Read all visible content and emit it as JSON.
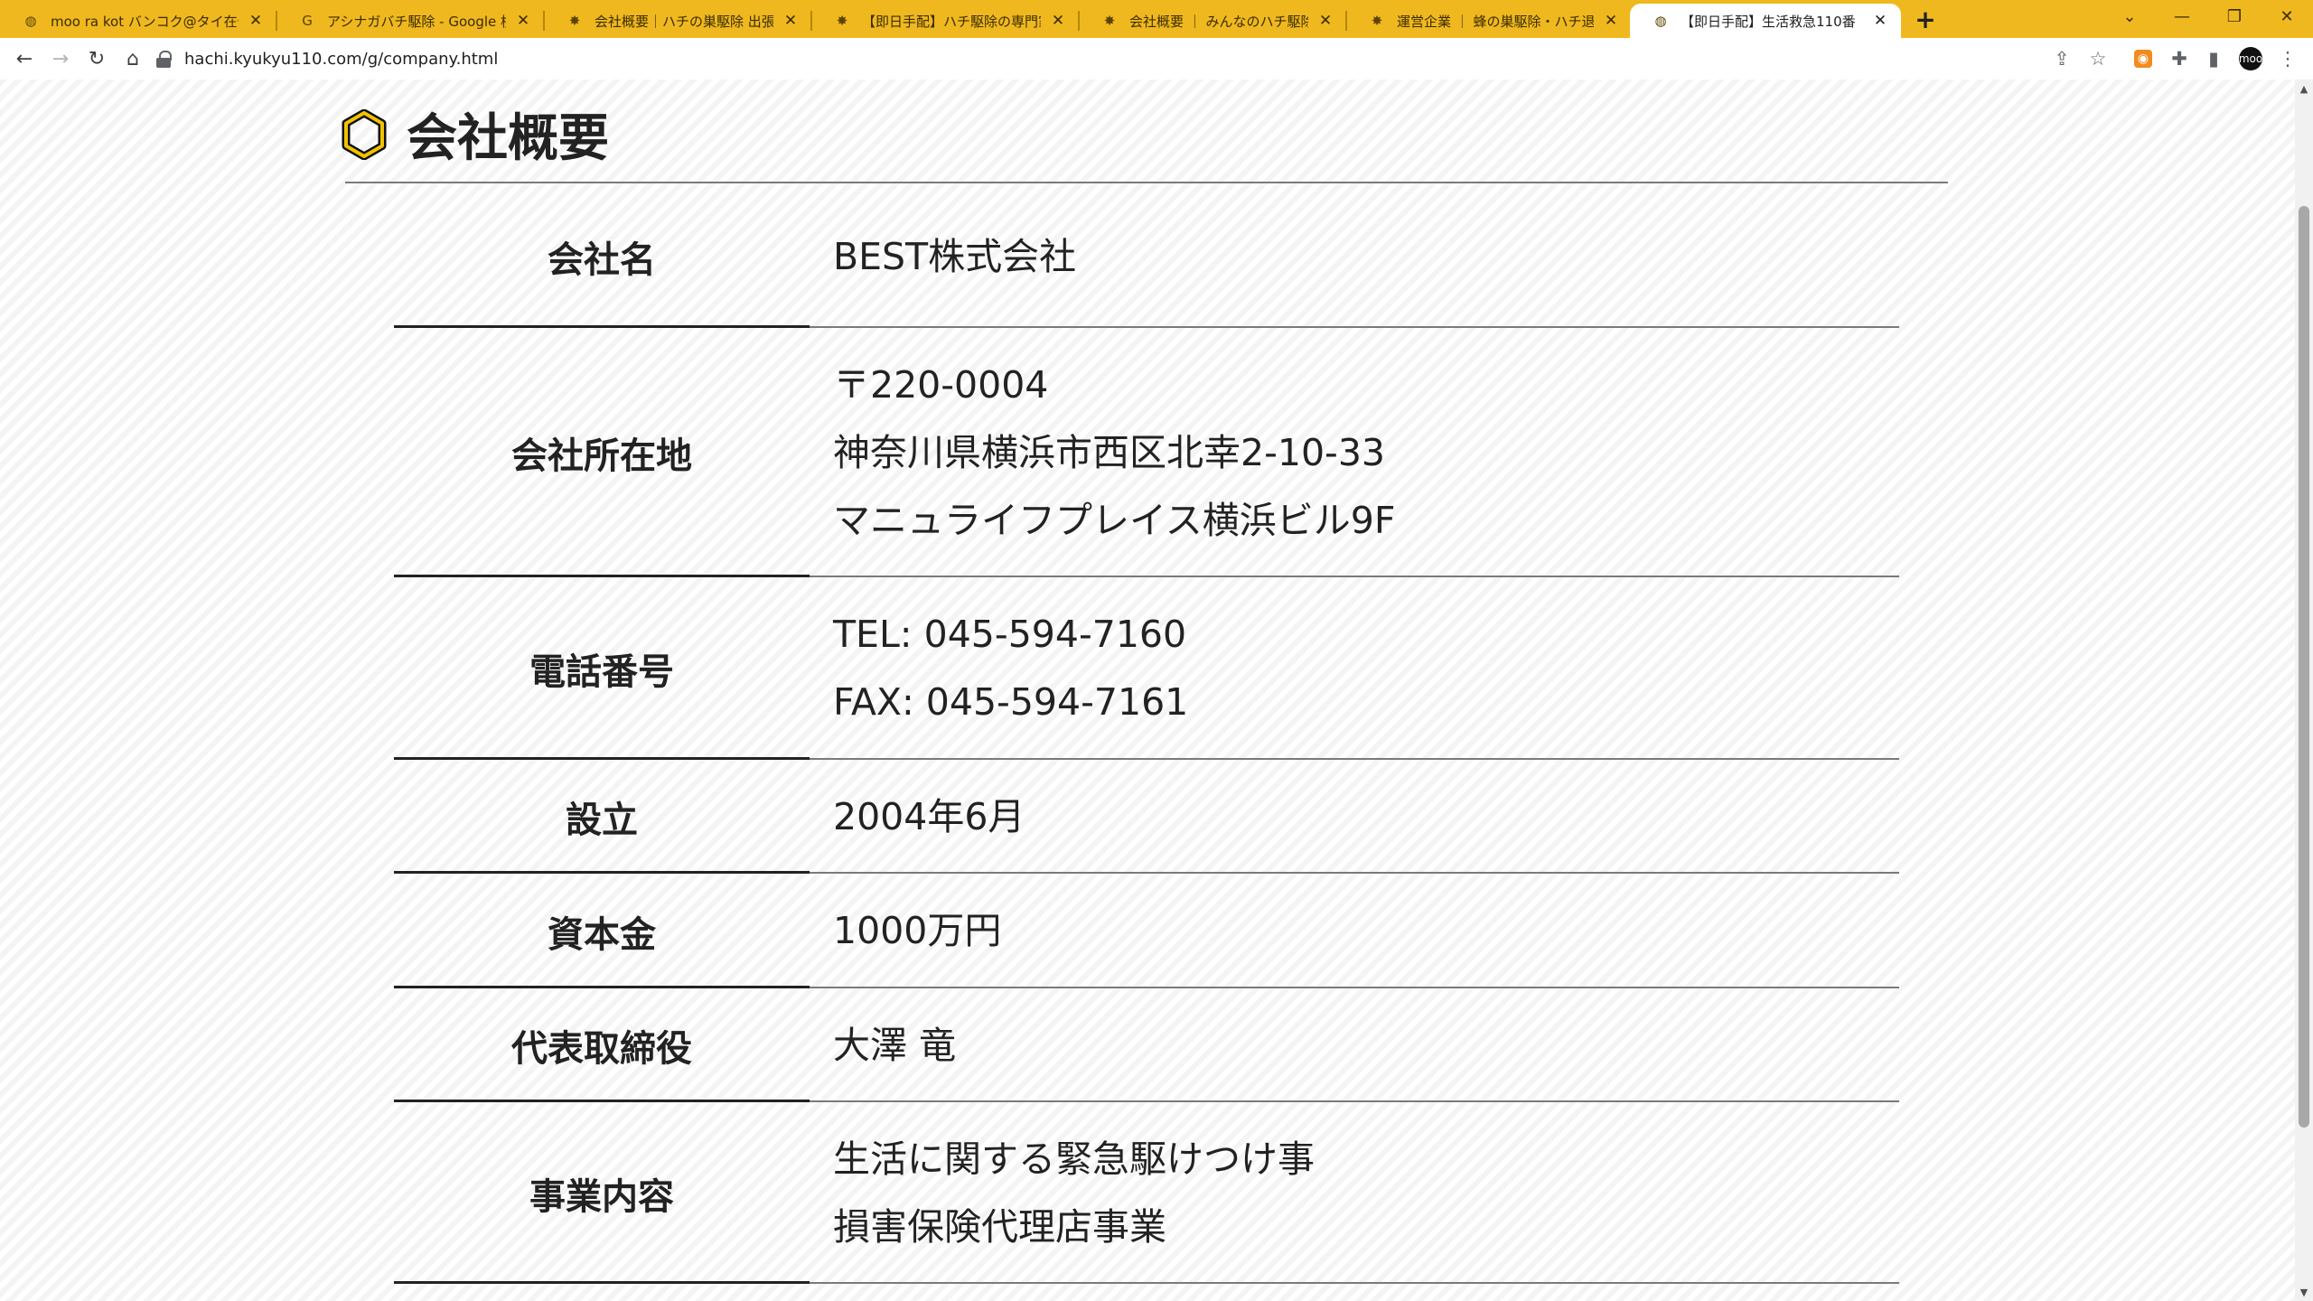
{
  "browser": {
    "tabs": [
      {
        "title": "moo ra kot バンコク@タイ在住／新",
        "icon": "globe-icon",
        "active": false
      },
      {
        "title": "アシナガバチ駆除 - Google 検索",
        "icon": "google-icon",
        "active": false
      },
      {
        "title": "会社概要｜ハチの巣駆除 出張専門",
        "icon": "bee-icon",
        "active": false
      },
      {
        "title": "【即日手配】ハチ駆除の専門家｜",
        "icon": "bee-icon",
        "active": false
      },
      {
        "title": "会社概要 ｜ みんなのハチ駆除屋さ",
        "icon": "bee-icon",
        "active": false
      },
      {
        "title": "運営企業 ｜ 蜂の巣駆除・ハチ退治",
        "icon": "bee-icon",
        "active": false
      },
      {
        "title": "【即日手配】生活救急110番",
        "icon": "globe-icon",
        "active": true
      }
    ],
    "url": "hachi.kyukyu110.com/g/company.html",
    "profile_label": "moo"
  },
  "page": {
    "title": "会社概要",
    "accent_color": "#f2c200",
    "rows": [
      {
        "label": "会社名",
        "lines": [
          "BEST株式会社"
        ]
      },
      {
        "label": "会社所在地",
        "lines": [
          "〒220-0004",
          "神奈川県横浜市西区北幸2-10-33",
          "マニュライフプレイス横浜ビル9F"
        ]
      },
      {
        "label": "電話番号",
        "lines": [
          "TEL: 045-594-7160",
          "FAX: 045-594-7161"
        ]
      },
      {
        "label": "設立",
        "lines": [
          "2004年6月"
        ]
      },
      {
        "label": "資本金",
        "lines": [
          "1000万円"
        ]
      },
      {
        "label": "代表取締役",
        "lines": [
          "大澤 竜"
        ]
      },
      {
        "label": "事業内容",
        "lines": [
          "生活に関する緊急駆けつけ事",
          "損害保険代理店事業"
        ]
      }
    ]
  }
}
